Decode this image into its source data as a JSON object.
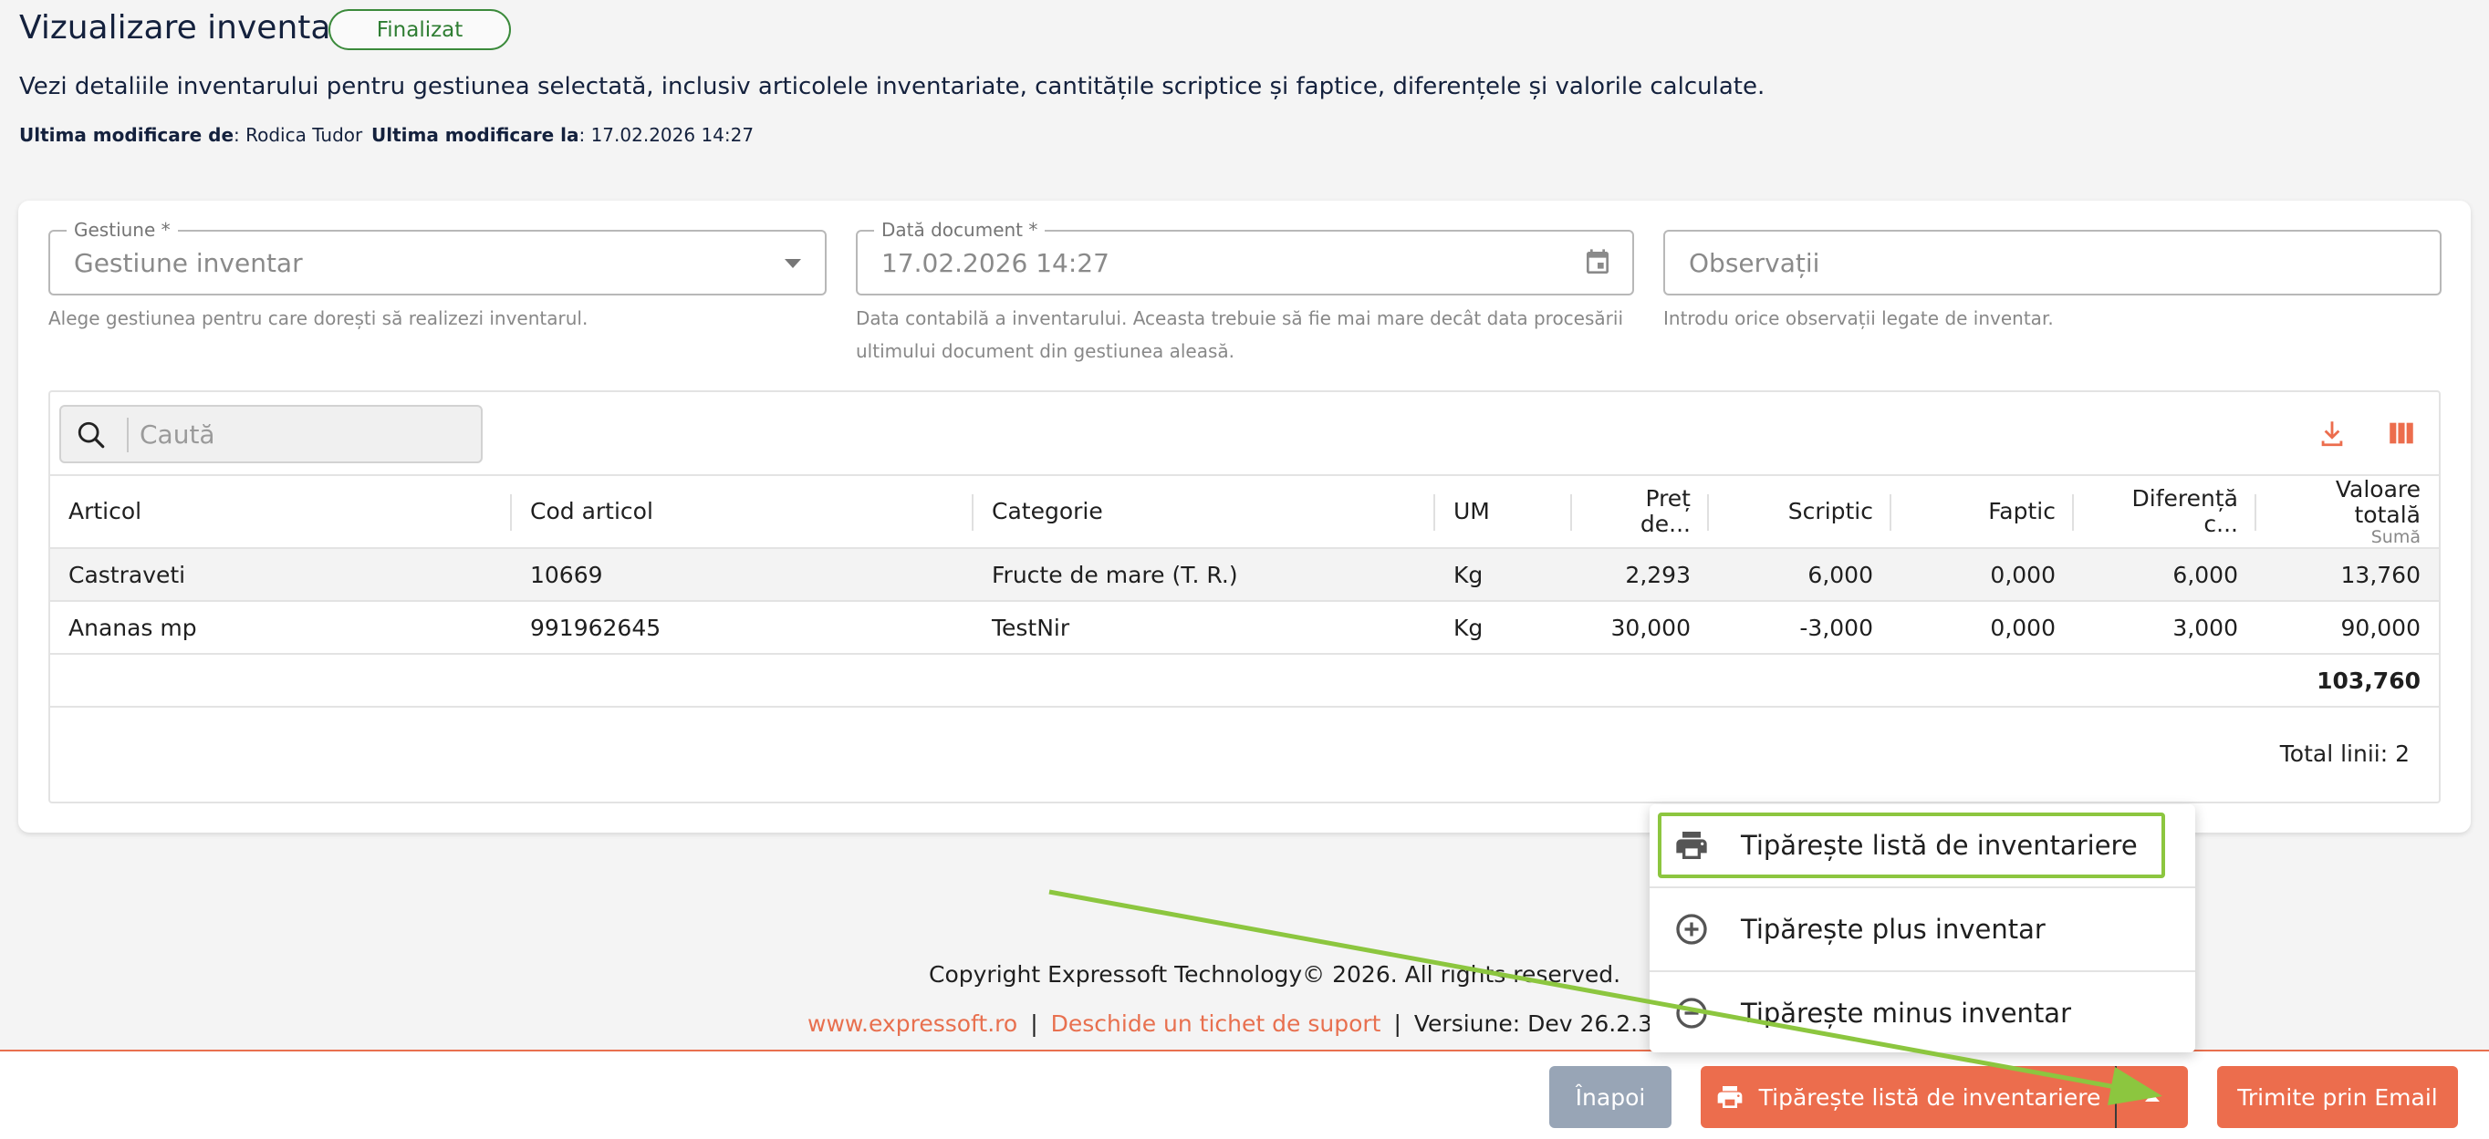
{
  "page": {
    "title": "Vizualizare inventar",
    "status": "Finalizat",
    "description": "Vezi detaliile inventarului pentru gestiunea selectată, inclusiv articolele inventariate, cantitățile scriptice și faptice, diferențele și valorile calculate.",
    "modified_by_label": "Ultima modificare de",
    "modified_by_value": ": Rodica Tudor",
    "modified_at_label": "Ultima modificare la",
    "modified_at_value": ": 17.02.2026 14:27"
  },
  "form": {
    "gestiune": {
      "label": "Gestiune *",
      "value": "Gestiune inventar",
      "helper": "Alege gestiunea pentru care dorești să realizezi inventarul."
    },
    "data_document": {
      "label": "Dată document *",
      "value": "17.02.2026 14:27",
      "helper_line1": "Data contabilă a inventarului. Aceasta trebuie să fie mai mare decât data procesării",
      "helper_line2": "ultimului document din gestiunea aleasă."
    },
    "observatii": {
      "placeholder": "Observații",
      "helper": "Introdu orice observații legate de inventar."
    }
  },
  "grid": {
    "search_placeholder": "Caută",
    "toolbar_icons": [
      "download-icon",
      "columns-icon"
    ],
    "columns": [
      {
        "label": "Articol",
        "sub": ""
      },
      {
        "label": "Cod articol",
        "sub": ""
      },
      {
        "label": "Categorie",
        "sub": ""
      },
      {
        "label": "UM",
        "sub": ""
      },
      {
        "label": "Preț de...",
        "sub": ""
      },
      {
        "label": "Scriptic",
        "sub": ""
      },
      {
        "label": "Faptic",
        "sub": ""
      },
      {
        "label": "Diferență c...",
        "sub": ""
      },
      {
        "label": "Valoare totală",
        "sub": "Sumă"
      }
    ],
    "rows": [
      [
        "Castraveti",
        "10669",
        "Fructe de mare (T. R.)",
        "Kg",
        "2,293",
        "6,000",
        "0,000",
        "6,000",
        "13,760"
      ],
      [
        "Ananas mp",
        "991962645",
        "TestNir",
        "Kg",
        "30,000",
        "-3,000",
        "0,000",
        "3,000",
        "90,000"
      ]
    ],
    "total_value": "103,760",
    "total_lines": "Total linii: 2"
  },
  "footer": {
    "copyright": "Copyright Expressoft Technology© 2026. All rights reserved.",
    "website": "www.expressoft.ro",
    "support_link": "Deschide un tichet de suport",
    "version": "Versiune: Dev 26.2.3.3.0"
  },
  "actions": {
    "back": "Înapoi",
    "print": "Tipărește listă de inventariere",
    "email": "Trimite prin Email"
  },
  "print_menu": {
    "items": [
      {
        "label": "Tipărește listă de inventariere",
        "icon": "print-icon"
      },
      {
        "label": "Tipărește plus inventar",
        "icon": "plus-circle-icon"
      },
      {
        "label": "Tipărește minus inventar",
        "icon": "minus-circle-icon"
      }
    ]
  },
  "colors": {
    "accent": "#ec6d4d",
    "status_green": "#2e7d32",
    "highlight": "#8cc63f",
    "back_button": "#98a5b6"
  }
}
